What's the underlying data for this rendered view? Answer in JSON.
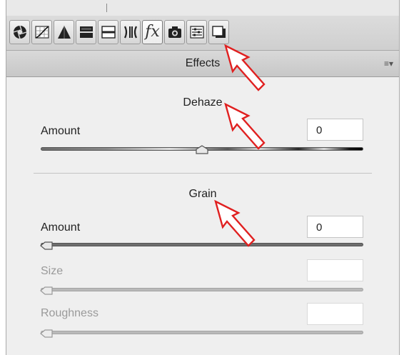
{
  "panel": {
    "header_title": "Effects",
    "menu_icon": "panel-menu-icon"
  },
  "tabs": [
    {
      "name": "basic-tab-icon",
      "active": false
    },
    {
      "name": "tone-curve-tab-icon",
      "active": false
    },
    {
      "name": "detail-tab-icon",
      "active": false
    },
    {
      "name": "hsl-tab-icon",
      "active": false
    },
    {
      "name": "split-toning-tab-icon",
      "active": false
    },
    {
      "name": "lens-corrections-tab-icon",
      "active": false
    },
    {
      "name": "effects-tab-icon",
      "active": true,
      "glyph": "fx"
    },
    {
      "name": "camera-calibration-tab-icon",
      "active": false
    },
    {
      "name": "presets-tab-icon",
      "active": false
    },
    {
      "name": "snapshots-tab-icon",
      "active": false
    }
  ],
  "dehaze": {
    "title": "Dehaze",
    "amount_label": "Amount",
    "amount_value": "0",
    "amount_fraction": 0.5
  },
  "grain": {
    "title": "Grain",
    "amount_label": "Amount",
    "amount_value": "0",
    "amount_fraction": 0.0,
    "size_label": "Size",
    "size_value": "",
    "size_fraction": 0.0,
    "roughness_label": "Roughness",
    "roughness_value": "",
    "roughness_fraction": 0.0
  },
  "colors": {
    "arrow": "#e02020",
    "panel_bg": "#efefef"
  }
}
